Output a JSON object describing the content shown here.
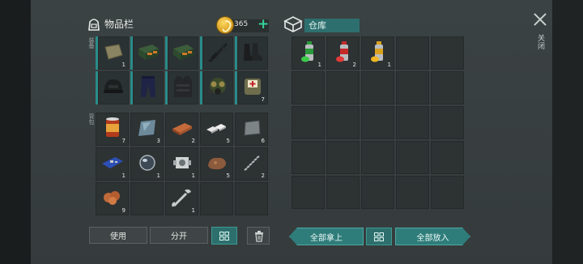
{
  "inventory": {
    "title": "物品栏",
    "coins": "365",
    "side_label_top": "装备",
    "side_label_bottom": "背包",
    "equipped": [
      {
        "name": "sandbag",
        "count": "1"
      },
      {
        "name": "green-case",
        "count": ""
      },
      {
        "name": "green-case",
        "count": ""
      },
      {
        "name": "rifle",
        "count": ""
      },
      {
        "name": "boots",
        "count": ""
      },
      {
        "name": "helmet",
        "count": ""
      },
      {
        "name": "pants",
        "count": ""
      },
      {
        "name": "vest",
        "count": ""
      },
      {
        "name": "gas-mask",
        "count": ""
      },
      {
        "name": "medic-backpack",
        "count": "7"
      }
    ],
    "backpack": [
      {
        "name": "canned-food",
        "count": "7"
      },
      {
        "name": "glass-plate",
        "count": "3"
      },
      {
        "name": "copper-bar",
        "count": "2"
      },
      {
        "name": "silver-bars",
        "count": "5"
      },
      {
        "name": "metal-plate",
        "count": "6"
      },
      {
        "name": "circuit-board",
        "count": "1"
      },
      {
        "name": "lens",
        "count": "1"
      },
      {
        "name": "engine-part",
        "count": "1"
      },
      {
        "name": "ore",
        "count": "5"
      },
      {
        "name": "spring",
        "count": "2"
      },
      {
        "name": "copper-ore",
        "count": "9"
      },
      {
        "name": "empty",
        "count": ""
      },
      {
        "name": "wrench",
        "count": "1"
      },
      {
        "name": "empty",
        "count": ""
      },
      {
        "name": "empty",
        "count": ""
      }
    ],
    "buttons": {
      "use": "使用",
      "split": "分开"
    }
  },
  "storage": {
    "title": "仓库",
    "items": [
      {
        "name": "green-spray-can",
        "count": "1"
      },
      {
        "name": "red-spray-can",
        "count": "2"
      },
      {
        "name": "yellow-spray-can",
        "count": "1"
      }
    ],
    "buttons": {
      "take_all": "全部拿上",
      "put_all": "全部放入"
    }
  },
  "close_label": "关闭",
  "colors": {
    "accent": "#2f7d7a",
    "teal_border": "#2a8c8a",
    "coin": "#d9a21f",
    "plus": "#37d39a"
  }
}
